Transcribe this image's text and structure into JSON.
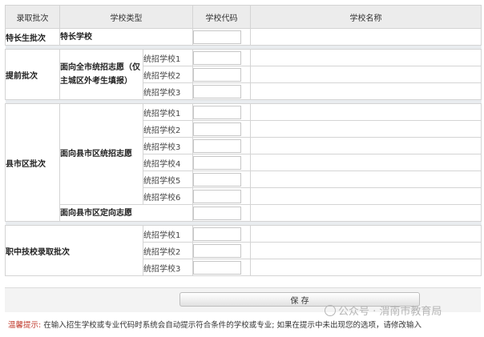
{
  "headers": {
    "batch": "录取批次",
    "school_type": "学校类型",
    "school_code": "学校代码",
    "school_name": "学校名称"
  },
  "rows": {
    "special": {
      "batch": "特长生批次",
      "type": "特长学校"
    },
    "advance": {
      "batch": "提前批次",
      "type": "面向全市统招志愿（仅主城区外考生填报）",
      "subs": [
        "统招学校1",
        "统招学校2",
        "统招学校3"
      ]
    },
    "county": {
      "batch": "县市区批次",
      "type": "面向县市区统招志愿",
      "subs": [
        "统招学校1",
        "统招学校2",
        "统招学校3",
        "统招学校4",
        "统招学校5",
        "统招学校6"
      ],
      "directed_type": "面向县市区定向志愿"
    },
    "vocational": {
      "batch": "职中技校录取批次",
      "subs": [
        "统招学校1",
        "统招学校2",
        "统招学校3"
      ]
    }
  },
  "save_label": "保 存",
  "tip": {
    "label": "温馨提示:",
    "text": "在输入招生学校或专业代码时系统会自动提示符合条件的学校或专业; 如果在提示中未出现您的选项，请修改输入"
  },
  "watermark": "公众号 · 渭南市教育局"
}
